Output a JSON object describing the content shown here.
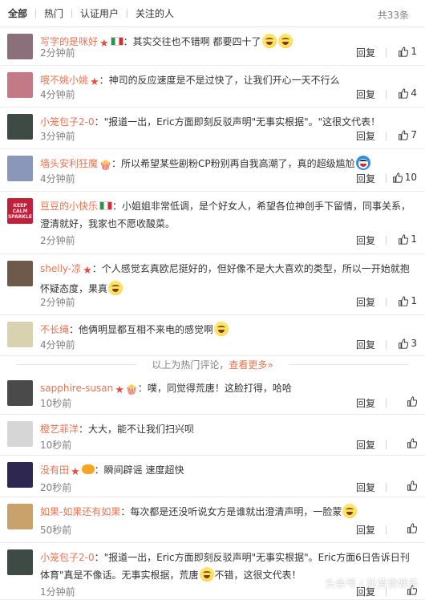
{
  "tabs": {
    "items": [
      "全部",
      "热门",
      "认证用户",
      "关注的人"
    ],
    "total": "共33条"
  },
  "actions": {
    "reply": "回复"
  },
  "comments": [
    {
      "user": "写字的是咪好",
      "badges": [
        "star",
        "flag"
      ],
      "text": "：其实交往也不错啊 都要四十了",
      "emojis": 2,
      "time": "2分钟前",
      "likes": "1",
      "avatar_color": "#8b6f7a"
    },
    {
      "user": "哦不姚小姚",
      "badges": [
        "star"
      ],
      "text": "：神司的反应速度是不是过快了，让我们开心一天不行么",
      "emojis": 0,
      "time": "4分钟前",
      "likes": "4",
      "avatar_color": "#c47a86"
    },
    {
      "user": "小笼包子2-0",
      "badges": [],
      "text": "：\"报道一出，Eric方面即刻反驳声明\"无事实根据\"。\"这很文代表！",
      "emojis": 0,
      "time": "3分钟前",
      "likes": "7",
      "avatar_color": "#3e4a44"
    },
    {
      "user": "墙头安利狂魔",
      "badges": [
        "pop"
      ],
      "text": "：所以希望某些剧粉CP粉别再自我高潮了，真的超级尴尬",
      "emojis": 1,
      "emoji_kind": "doraemon",
      "time": "4分钟前",
      "likes": "10",
      "avatar_color": "#8a97b8"
    },
    {
      "user": "豆豆的小快乐",
      "badges": [
        "flag"
      ],
      "text": "：小姐姐非常低调，是个好女人，希望各位神创手下留情，同事关系，澄清就好，我家也不愿收酸菜。",
      "emojis": 0,
      "time": "2分钟前",
      "likes": "1",
      "avatar_color": "#c0203a",
      "avatar_text": "KEEP CALM SPARKLE"
    },
    {
      "user": "shelly-凉",
      "badges": [
        "star"
      ],
      "text": "：个人感觉玄真欧尼挺好的，但好像不是大大喜欢的类型，所以一开始就抱怀疑态度，果真",
      "emojis": 1,
      "time": "2分钟前",
      "likes": "1",
      "avatar_color": "#6e5a4a"
    },
    {
      "user": "不长绳",
      "badges": [],
      "text": "：他俩明显都互相不来电的感觉啊",
      "emojis": 1,
      "time": "4分钟前",
      "likes": "3",
      "avatar_color": "#d9d2b0"
    },
    {
      "user": "sapphire-susan",
      "badges": [
        "star",
        "pop"
      ],
      "text": "：噗，同觉得荒唐！这脸打得，哈哈",
      "emojis": 0,
      "time": "10秒前",
      "likes": "",
      "avatar_color": "#4a4a4a"
    },
    {
      "user": "橙艺菲洋",
      "badges": [],
      "text": "：大大，能不让我们扫兴呗",
      "emojis": 0,
      "time": "10秒前",
      "likes": "",
      "avatar_color": "#d6d6d6"
    },
    {
      "user": "没有田",
      "badges": [
        "star",
        "vip"
      ],
      "text": "：瞬间辟谣 速度超快",
      "emojis": 0,
      "time": "20秒前",
      "likes": "",
      "avatar_color": "#2e2850"
    },
    {
      "user": "如果-如果还有如果",
      "badges": [],
      "text": "：每次都是还没听说女方是谁就出澄清声明，一脸蒙",
      "emojis": 1,
      "time": "50秒前",
      "likes": "",
      "avatar_color": "#c9a16a"
    },
    {
      "user": "小笼包子2-0",
      "badges": [],
      "text": "：\"报道一出，Eric方面即刻反驳声明\"无事实根据\"。Eric方面6日告诉日刊体育\"真是不像话。无事实根据，荒唐",
      "text_tail": "不错，这很文代表！",
      "emojis": 1,
      "time": "1分钟前",
      "likes": "",
      "avatar_color": "#3e4a44"
    }
  ],
  "hotbar": {
    "text": "以上为热门评论，",
    "more": "查看更多»"
  },
  "watermark": "头条号 / 新黄昏娱乐",
  "colors": {
    "accent": "#eb7350",
    "muted": "#808080",
    "star": "#e84b3a"
  }
}
